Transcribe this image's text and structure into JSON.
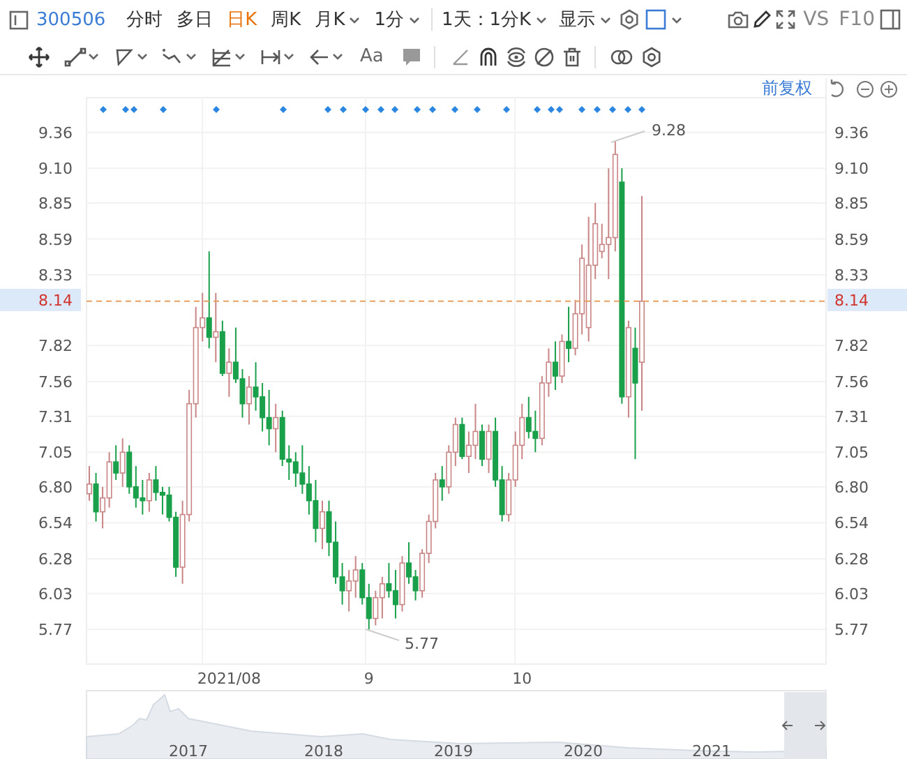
{
  "toolbar": {
    "code": "300506",
    "periods": [
      {
        "label": "分时",
        "selected": false,
        "kind": "tab"
      },
      {
        "label": "多日",
        "selected": false,
        "kind": "tab"
      },
      {
        "label": "日K",
        "selected": true,
        "kind": "tab"
      },
      {
        "label": "周K",
        "selected": false,
        "kind": "tab"
      },
      {
        "label": "月K",
        "selected": false,
        "kind": "dropdown"
      },
      {
        "label": "1分",
        "selected": false,
        "kind": "dropdown"
      }
    ],
    "range": "1天：1分K",
    "display": "显示",
    "compare": "VS",
    "f10": "F10"
  },
  "drawing_tools": {
    "text_tool": "Aa"
  },
  "chart": {
    "adjust_label": "前复权",
    "right_axis": [
      "9.36",
      "9.10",
      "8.85",
      "8.59",
      "8.33",
      "7.82",
      "7.56",
      "7.31",
      "7.05",
      "6.80",
      "6.54",
      "6.28",
      "6.03",
      "5.77"
    ],
    "price_line": {
      "left_label": "8.14",
      "right_label": "8.14"
    },
    "high_label": "9.28",
    "low_label": "5.77",
    "chart_data": {
      "type": "candlestick",
      "ylim": [
        5.52,
        9.61
      ],
      "grid": true,
      "ref_lines": [
        {
          "axis": "y",
          "value": 8.14
        }
      ],
      "yticks": [
        {
          "value": 9.36,
          "label": "9.36"
        },
        {
          "value": 9.1,
          "label": "9.10"
        },
        {
          "value": 8.85,
          "label": "8.85"
        },
        {
          "value": 8.59,
          "label": "8.59"
        },
        {
          "value": 8.33,
          "label": "8.33"
        },
        {
          "value": 7.82,
          "label": "7.82"
        },
        {
          "value": 7.56,
          "label": "7.56"
        },
        {
          "value": 7.31,
          "label": "7.31"
        },
        {
          "value": 7.05,
          "label": "7.05"
        },
        {
          "value": 6.8,
          "label": "6.80"
        },
        {
          "value": 6.54,
          "label": "6.54"
        },
        {
          "value": 6.28,
          "label": "6.28"
        },
        {
          "value": 6.03,
          "label": "6.03"
        },
        {
          "value": 5.77,
          "label": "5.77"
        }
      ],
      "categories": [
        null,
        null,
        null,
        null,
        null,
        null,
        null,
        null,
        null,
        null,
        null,
        null,
        null,
        null,
        null,
        null,
        null,
        null,
        null,
        null,
        null,
        "2021/08",
        null,
        null,
        null,
        null,
        null,
        null,
        null,
        null,
        null,
        null,
        null,
        null,
        null,
        null,
        null,
        null,
        null,
        null,
        null,
        null,
        "9",
        null,
        null,
        null,
        null,
        null,
        null,
        null,
        null,
        null,
        null,
        null,
        null,
        null,
        null,
        null,
        null,
        null,
        null,
        null,
        null,
        null,
        null,
        "10",
        null,
        null,
        null,
        null,
        null,
        null,
        null,
        null,
        null,
        null,
        null,
        null,
        null,
        null,
        null,
        null,
        null,
        null
      ],
      "ohlc": [
        [
          6.75,
          6.95,
          6.7,
          6.82
        ],
        [
          6.82,
          6.9,
          6.55,
          6.62
        ],
        [
          6.62,
          6.8,
          6.5,
          6.72
        ],
        [
          6.72,
          7.05,
          6.65,
          6.98
        ],
        [
          6.98,
          7.1,
          6.85,
          6.9
        ],
        [
          6.9,
          7.15,
          6.8,
          7.05
        ],
        [
          7.05,
          7.1,
          6.75,
          6.8
        ],
        [
          6.8,
          6.95,
          6.65,
          6.72
        ],
        [
          6.72,
          6.85,
          6.6,
          6.7
        ],
        [
          6.7,
          6.9,
          6.62,
          6.85
        ],
        [
          6.85,
          6.95,
          6.7,
          6.76
        ],
        [
          6.76,
          6.8,
          6.6,
          6.74
        ],
        [
          6.74,
          6.8,
          6.55,
          6.58
        ],
        [
          6.58,
          6.62,
          6.15,
          6.22
        ],
        [
          6.22,
          6.7,
          6.1,
          6.6
        ],
        [
          6.6,
          7.5,
          6.55,
          7.4
        ],
        [
          7.4,
          8.1,
          7.3,
          7.95
        ],
        [
          7.95,
          8.2,
          7.85,
          8.02
        ],
        [
          8.02,
          8.5,
          7.8,
          7.88
        ],
        [
          7.88,
          8.2,
          7.7,
          7.92
        ],
        [
          7.92,
          8.0,
          7.6,
          7.62
        ],
        [
          7.62,
          7.8,
          7.45,
          7.7
        ],
        [
          7.7,
          7.95,
          7.55,
          7.58
        ],
        [
          7.58,
          7.65,
          7.3,
          7.4
        ],
        [
          7.4,
          7.6,
          7.25,
          7.52
        ],
        [
          7.52,
          7.7,
          7.35,
          7.45
        ],
        [
          7.45,
          7.55,
          7.2,
          7.3
        ],
        [
          7.3,
          7.5,
          7.1,
          7.22
        ],
        [
          7.22,
          7.4,
          7.05,
          7.3
        ],
        [
          7.3,
          7.35,
          6.95,
          7.0
        ],
        [
          7.0,
          7.1,
          6.85,
          6.98
        ],
        [
          6.98,
          7.05,
          6.8,
          6.9
        ],
        [
          6.9,
          7.1,
          6.75,
          6.82
        ],
        [
          6.82,
          6.95,
          6.6,
          6.7
        ],
        [
          6.7,
          6.85,
          6.4,
          6.5
        ],
        [
          6.5,
          6.7,
          6.35,
          6.62
        ],
        [
          6.62,
          6.7,
          6.3,
          6.4
        ],
        [
          6.4,
          6.55,
          6.1,
          6.15
        ],
        [
          6.15,
          6.25,
          5.95,
          6.05
        ],
        [
          6.05,
          6.2,
          5.9,
          6.12
        ],
        [
          6.12,
          6.3,
          6.0,
          6.2
        ],
        [
          6.2,
          6.25,
          5.95,
          6.0
        ],
        [
          6.0,
          6.1,
          5.77,
          5.85
        ],
        [
          5.85,
          6.05,
          5.8,
          6.0
        ],
        [
          6.0,
          6.15,
          5.85,
          6.1
        ],
        [
          6.1,
          6.25,
          6.0,
          6.05
        ],
        [
          6.05,
          6.2,
          5.85,
          5.95
        ],
        [
          5.95,
          6.3,
          5.9,
          6.25
        ],
        [
          6.25,
          6.4,
          6.1,
          6.15
        ],
        [
          6.15,
          6.2,
          5.98,
          6.05
        ],
        [
          6.05,
          6.35,
          6.0,
          6.32
        ],
        [
          6.32,
          6.6,
          6.25,
          6.55
        ],
        [
          6.55,
          6.9,
          6.5,
          6.85
        ],
        [
          6.85,
          6.95,
          6.7,
          6.8
        ],
        [
          6.8,
          7.1,
          6.75,
          7.05
        ],
        [
          7.05,
          7.3,
          6.95,
          7.25
        ],
        [
          7.25,
          7.3,
          7.0,
          7.02
        ],
        [
          7.02,
          7.2,
          6.9,
          7.1
        ],
        [
          7.1,
          7.4,
          7.0,
          7.2
        ],
        [
          7.2,
          7.25,
          6.95,
          7.0
        ],
        [
          7.0,
          7.25,
          6.9,
          7.2
        ],
        [
          7.2,
          7.3,
          6.8,
          6.85
        ],
        [
          6.85,
          6.95,
          6.55,
          6.6
        ],
        [
          6.6,
          6.9,
          6.55,
          6.85
        ],
        [
          6.85,
          7.2,
          6.8,
          7.1
        ],
        [
          7.1,
          7.4,
          7.0,
          7.3
        ],
        [
          7.3,
          7.45,
          7.15,
          7.2
        ],
        [
          7.2,
          7.35,
          7.05,
          7.15
        ],
        [
          7.15,
          7.6,
          7.1,
          7.55
        ],
        [
          7.55,
          7.8,
          7.45,
          7.7
        ],
        [
          7.7,
          7.85,
          7.5,
          7.6
        ],
        [
          7.6,
          7.9,
          7.55,
          7.85
        ],
        [
          7.85,
          8.1,
          7.7,
          7.8
        ],
        [
          7.8,
          8.15,
          7.75,
          8.05
        ],
        [
          8.05,
          8.55,
          7.9,
          8.45
        ],
        [
          7.95,
          8.75,
          7.85,
          8.4
        ],
        [
          8.4,
          8.85,
          8.3,
          8.7
        ],
        [
          8.5,
          8.7,
          8.45,
          8.55
        ],
        [
          8.55,
          9.1,
          8.3,
          8.6
        ],
        [
          8.6,
          9.3,
          8.5,
          9.2
        ],
        [
          9.0,
          9.1,
          7.4,
          7.45
        ],
        [
          7.45,
          8.0,
          7.3,
          7.95
        ],
        [
          7.8,
          7.95,
          7.0,
          7.55
        ],
        [
          7.7,
          8.9,
          7.35,
          8.14
        ]
      ]
    }
  },
  "navigator": {
    "years": [
      "2017",
      "2018",
      "2019",
      "2020",
      "2021"
    ]
  }
}
